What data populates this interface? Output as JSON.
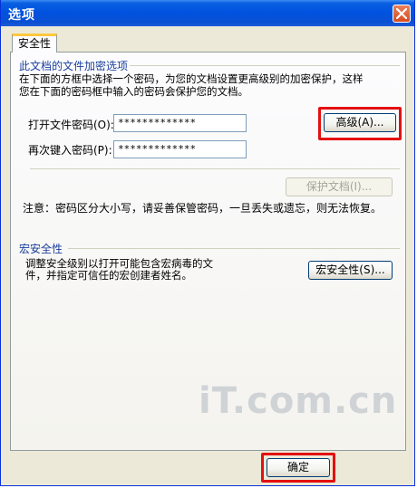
{
  "window": {
    "title": "选项"
  },
  "tabs": [
    {
      "label": "安全性"
    }
  ],
  "encryption_group": {
    "title": "此文档的文件加密选项",
    "description_line1": "在下面的方框中选择一个密码，为您的文档设置更高级别的加密保护，这样",
    "description_line2": "您在下面的密码框中输入的密码会保护您的文档。",
    "open_password_label": "打开文件密码(O):",
    "open_password_value": "*************",
    "reenter_password_label": "再次键入密码(P):",
    "reenter_password_value": "*************",
    "advanced_button": "高级(A)...",
    "protect_document_button": "保护文档(I)...",
    "note": "注意：密码区分大小写，请妥善保管密码，一旦丢失或遗忘，则无法恢复。"
  },
  "macro_group": {
    "title": "宏安全性",
    "description_line1": "调整安全级别以打开可能包含宏病毒的文",
    "description_line2": "件，并指定可信任的宏创建者姓名。",
    "macro_security_button": "宏安全性(S)..."
  },
  "footer": {
    "ok_button": "确定"
  },
  "watermark": {
    "text": "iT.com.cn"
  },
  "colors": {
    "titlebar": "#0052df",
    "group_title": "#1b3f9c",
    "highlight": "#e41010"
  }
}
